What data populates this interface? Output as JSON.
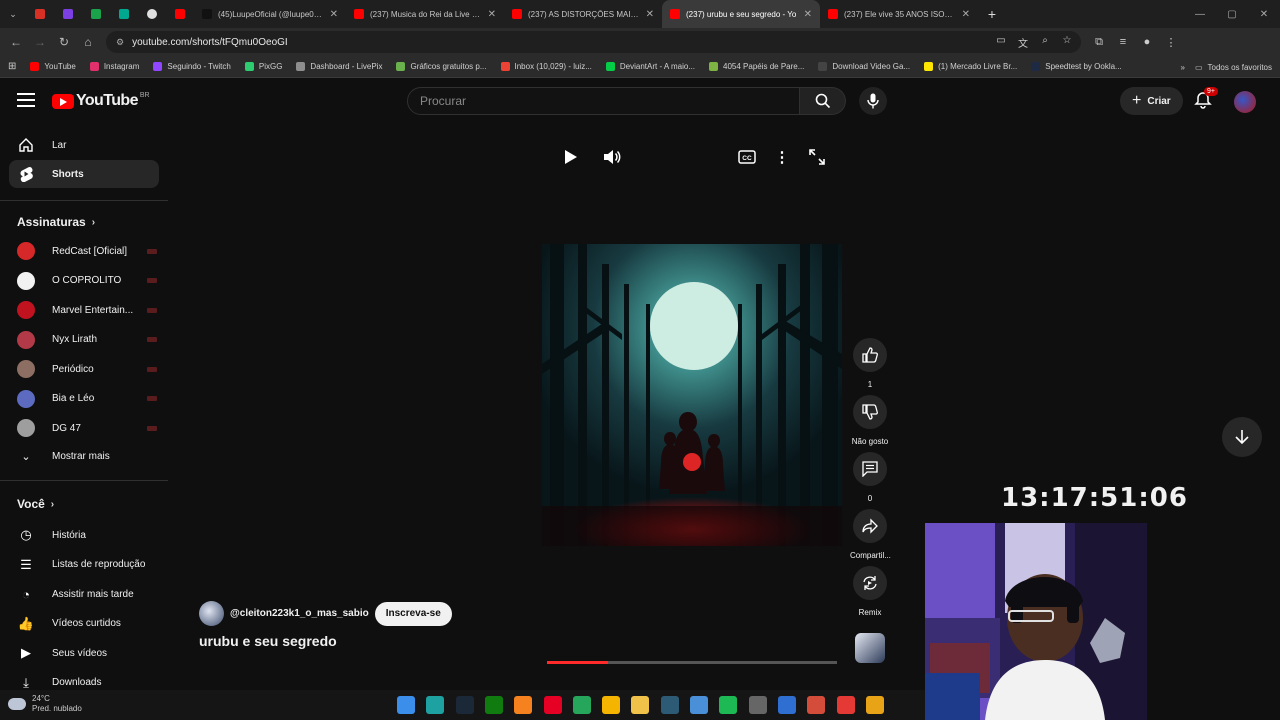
{
  "browser": {
    "tabs": [
      {
        "title": "",
        "color": "#d93025",
        "pinned": true
      },
      {
        "title": "",
        "color": "#7b3fe4",
        "pinned": true
      },
      {
        "title": "",
        "color": "#1aa34a",
        "pinned": true
      },
      {
        "title": "",
        "color": "#00a88f",
        "pinned": true
      },
      {
        "title": "",
        "color": "#e0e0e0",
        "pinned": true
      },
      {
        "title": "",
        "color": "#ff0000",
        "pinned": true
      },
      {
        "title": "(45)LuupeOficial (@luupe0ficial",
        "color": "#111111",
        "active": false
      },
      {
        "title": "(237) Musica do Rei da Live - Yo",
        "color": "#ff0000",
        "active": false
      },
      {
        "title": "(237) AS DISTORÇÕES MAIS CA",
        "color": "#ff0000",
        "active": false
      },
      {
        "title": "(237) urubu e seu segredo - Yo",
        "color": "#ff0000",
        "active": true
      },
      {
        "title": "(237) Ele vive 35 ANOS ISOLAD",
        "color": "#ff0000",
        "active": false
      }
    ],
    "new_tab_label": "+",
    "url": "youtube.com/shorts/tFQmu0OeoGI",
    "bookmarks": [
      {
        "label": "YouTube",
        "color": "#ff0000"
      },
      {
        "label": "Instagram",
        "color": "#e1306c"
      },
      {
        "label": "Seguindo - Twitch",
        "color": "#9146ff"
      },
      {
        "label": "PixGG",
        "color": "#2ecc71"
      },
      {
        "label": "Dashboard - LivePix",
        "color": "#8e8e8e"
      },
      {
        "label": "Gráficos gratuitos p...",
        "color": "#6ab04c"
      },
      {
        "label": "Inbox (10,029) - luiz...",
        "color": "#ea4335"
      },
      {
        "label": "DeviantArt - A maio...",
        "color": "#05cc47"
      },
      {
        "label": "4054 Papéis de Pare...",
        "color": "#7cb342"
      },
      {
        "label": "Download Video Ga...",
        "color": "#444444"
      },
      {
        "label": "(1) Mercado Livre Br...",
        "color": "#ffe600"
      },
      {
        "label": "Speedtest by Ookla...",
        "color": "#1e2a44"
      }
    ],
    "all_bookmarks_label": "Todos os favoritos"
  },
  "header": {
    "logo_text": "YouTube",
    "country_code": "BR",
    "search_placeholder": "Procurar",
    "create_label": "Criar",
    "notifications_badge": "9+"
  },
  "sidebar": {
    "main": [
      {
        "label": "Lar",
        "icon": "home-icon",
        "selected": false
      },
      {
        "label": "Shorts",
        "icon": "shorts-icon",
        "selected": true
      }
    ],
    "subscriptions_heading": "Assinaturas",
    "subscriptions": [
      {
        "name": "RedCast [Oficial]",
        "color": "#d62828"
      },
      {
        "name": "O COPRÓLITO",
        "color": "#f2f2f2"
      },
      {
        "name": "Marvel Entertain...",
        "color": "#c1121f"
      },
      {
        "name": "Nyx Lirath",
        "color": "#b23a48"
      },
      {
        "name": "Periódico",
        "color": "#8d6e63"
      },
      {
        "name": "Bia e Léo",
        "color": "#5c6bc0"
      },
      {
        "name": "DG 47",
        "color": "#9e9e9e"
      }
    ],
    "show_more_label": "Mostrar mais",
    "you_heading": "Você",
    "you_items": [
      {
        "label": "História",
        "icon": "history-icon"
      },
      {
        "label": "Listas de reprodução",
        "icon": "playlist-icon"
      },
      {
        "label": "Assistir mais tarde",
        "icon": "watch-later-icon"
      },
      {
        "label": "Vídeos curtidos",
        "icon": "like-icon"
      },
      {
        "label": "Seus vídeos",
        "icon": "your-videos-icon"
      },
      {
        "label": "Downloads",
        "icon": "download-icon"
      }
    ]
  },
  "short": {
    "channel_handle": "@cleiton223k1_o_mas_sabio",
    "subscribe_label": "Inscreva-se",
    "title": "urubu e seu segredo",
    "progress": 0.21,
    "actions": {
      "like_count": "1",
      "dislike_label": "Não gosto",
      "comment_count": "0",
      "share_label": "Compartil...",
      "remix_label": "Remix"
    }
  },
  "overlay": {
    "clock": "13:17:51:06"
  },
  "taskbar": {
    "temperature": "24°C",
    "weather": "Pred. nublado",
    "apps": [
      {
        "name": "windows-start",
        "color": "#3b8eea"
      },
      {
        "name": "edge",
        "color": "#1da1a1"
      },
      {
        "name": "steam",
        "color": "#1b2838"
      },
      {
        "name": "xbox",
        "color": "#107c10"
      },
      {
        "name": "app-orange",
        "color": "#f5821f"
      },
      {
        "name": "pinterest",
        "color": "#e60023"
      },
      {
        "name": "app-green",
        "color": "#26a65b"
      },
      {
        "name": "chrome",
        "color": "#f4b400"
      },
      {
        "name": "file-explorer",
        "color": "#f0c24a"
      },
      {
        "name": "app-dark",
        "color": "#2d5b75"
      },
      {
        "name": "notepad",
        "color": "#4a90d9"
      },
      {
        "name": "spotify",
        "color": "#1db954"
      },
      {
        "name": "steering",
        "color": "#666666"
      },
      {
        "name": "app-blue",
        "color": "#2f6fd1"
      },
      {
        "name": "app-mixed",
        "color": "#d44c3a"
      },
      {
        "name": "app-red",
        "color": "#e53935"
      },
      {
        "name": "chrome-active",
        "color": "#e8a317"
      }
    ]
  }
}
